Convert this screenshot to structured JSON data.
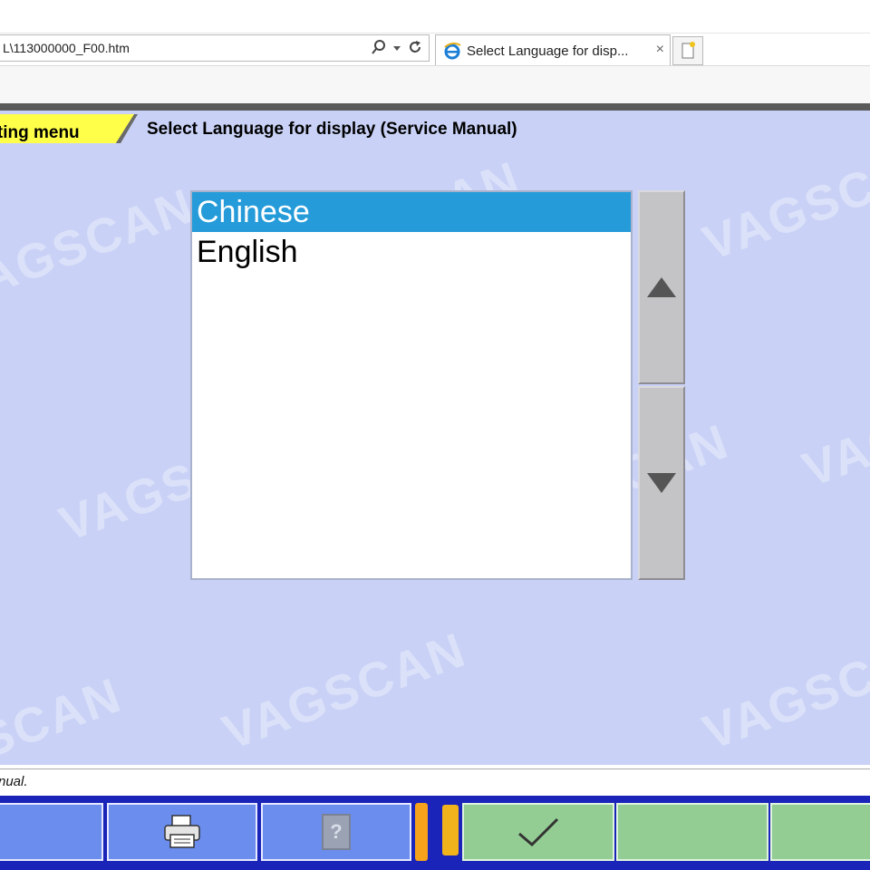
{
  "browser": {
    "address": "L\\113000000_F00.htm",
    "tab_title": "Select Language for disp...",
    "tab_close": "×"
  },
  "app": {
    "breadcrumb": "etting menu",
    "title": "Select Language for display (Service Manual)",
    "languages": [
      {
        "label": "Chinese",
        "selected": true
      },
      {
        "label": "English",
        "selected": false
      }
    ],
    "watermark": "VAGSCAN",
    "status_text": "nual."
  },
  "colors": {
    "app_background": "#c9d2f6",
    "selection": "#259bd9",
    "breadcrumb": "#ffff4a",
    "toolbar": "#1a24b8",
    "toolbar_blue_button": "#6b8dee",
    "toolbar_green_button": "#93cd93"
  },
  "icons": {
    "search": "search-icon",
    "refresh": "refresh-icon",
    "ie": "ie-logo-icon",
    "new_tab": "new-tab-icon",
    "scroll_up": "arrow-up-icon",
    "scroll_down": "arrow-down-icon",
    "print": "printer-icon",
    "help": "help-icon",
    "ok": "checkmark-icon"
  }
}
